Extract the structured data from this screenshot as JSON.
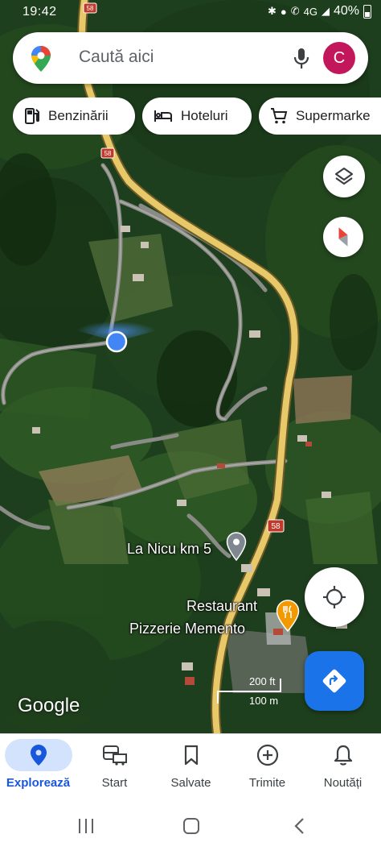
{
  "status_bar": {
    "time": "19:42",
    "battery": "40%",
    "icons": [
      "bluetooth-icon",
      "location-icon",
      "call-icon",
      "signal-4g-icon",
      "wifi-icon",
      "battery-icon"
    ]
  },
  "search": {
    "placeholder": "Caută aici",
    "avatar_letter": "C"
  },
  "chips": [
    {
      "label": "Benzinării",
      "icon": "gas-station-icon"
    },
    {
      "label": "Hoteluri",
      "icon": "hotel-bed-icon"
    },
    {
      "label": "Supermarke",
      "icon": "shopping-cart-icon"
    }
  ],
  "map": {
    "road_shields": [
      "58",
      "58",
      "58"
    ],
    "pois": [
      {
        "name": "La Nicu km 5",
        "icon": "pin-icon"
      },
      {
        "name_line1": "Restaurant",
        "name_line2": "Pizzerie Memento",
        "icon": "restaurant-icon"
      }
    ],
    "scale_top": "200 ft",
    "scale_bottom": "100 m",
    "attribution": "Google"
  },
  "bottom_nav": [
    {
      "label": "Explorează",
      "icon": "explore-pin-icon",
      "active": true
    },
    {
      "label": "Start",
      "icon": "commute-icon",
      "active": false
    },
    {
      "label": "Salvate",
      "icon": "bookmark-icon",
      "active": false
    },
    {
      "label": "Trimite",
      "icon": "add-circle-icon",
      "active": false
    },
    {
      "label": "Noutăți",
      "icon": "bell-icon",
      "active": false
    }
  ],
  "colors": {
    "accent": "#1a73e8",
    "avatar": "#c2185b",
    "road": "#e8c96a",
    "poi_orange": "#f29900"
  }
}
